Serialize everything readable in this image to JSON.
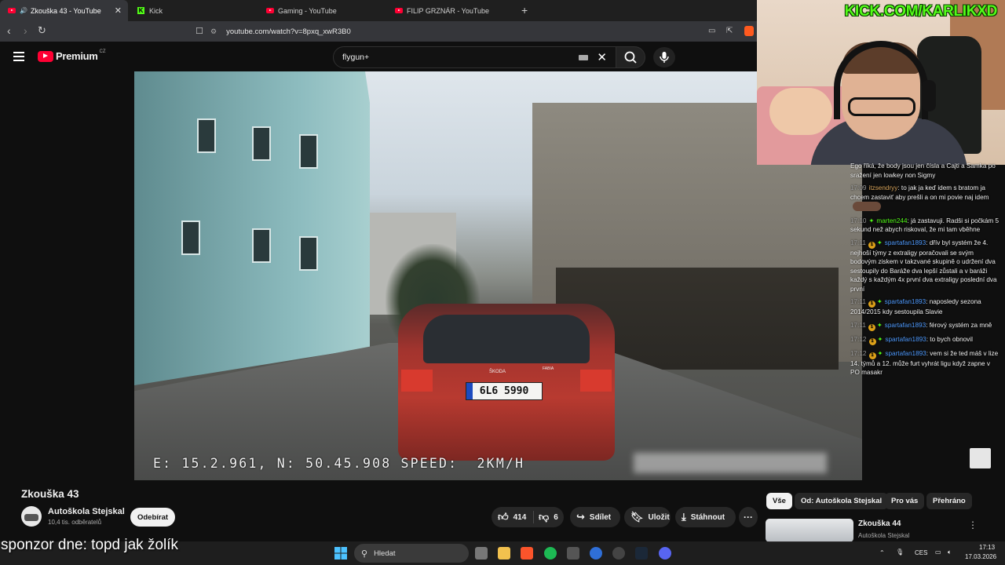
{
  "browser": {
    "tabs": [
      {
        "label": "Zkouška 43 - YouTube",
        "icon": "youtube-icon",
        "active": true
      },
      {
        "label": "Kick",
        "icon": "kick-icon"
      },
      {
        "label": "Gaming - YouTube",
        "icon": "youtube-icon"
      },
      {
        "label": "FILIP GRZNÁR - YouTube",
        "icon": "youtube-icon"
      }
    ],
    "url": "youtube.com/watch?v=8pxq_xwR3B0"
  },
  "youtube": {
    "logo_text": "Premium",
    "logo_region": "CZ",
    "search_query": "flygun+",
    "video": {
      "osd_text": "E: 15.2.961, N: 50.45.908 SPEED:  2KM/H",
      "plate": "6L6 5990",
      "car_badge": "ŠKODA",
      "car_model": "FABIA"
    },
    "title": "Zkouška 43",
    "channel": {
      "name": "Autoškola Stejskal",
      "subscribers": "10,4 tis. odběratelů"
    },
    "subscribe_label": "Odebírat",
    "actions": {
      "likes": "414",
      "dislikes": "6",
      "share": "Sdílet",
      "save": "Uložit",
      "download": "Stáhnout",
      "more": "···"
    },
    "chips": [
      "Vše",
      "Od: Autoškola Stejskal",
      "Pro vás",
      "Přehráno"
    ],
    "related": {
      "title": "Zkouška 44",
      "channel": "Autoškola Stejskal"
    }
  },
  "stream": {
    "kick_tag": "KICK.COM/KARLIKXD",
    "sponsor": "sponzor dne: topd jak žolík",
    "chat": [
      {
        "time": "",
        "user": "",
        "text": "Ego říká, že body jsou jen čísla a Cajti a Samka po sražení jen lowkey non Sigmy",
        "badges": false
      },
      {
        "time": "17:09",
        "user": "itzsendryy",
        "text": "to jak ja keď idem s bratom ja chcem zastaviť aby prešli a on mi povie naj idem",
        "badges": false,
        "emote": true
      },
      {
        "time": "17:10",
        "user": "marten244",
        "text": "já zastavuji. Radši si počkám 5 sekund než abych riskoval, že mi tam vběhne",
        "badges": true
      },
      {
        "time": "17:11",
        "user": "spartafan1893",
        "text": "dřív byl systém že 4. nejhoší týmy z extraligy poračovali se svým bodovým ziskem v takzvané skupině o udržení dva sestoupily do Baráže dva lepší zůstali a v baráži každý s každým 4x první dva extraligy poslední dva první",
        "badges": true
      },
      {
        "time": "17:11",
        "user": "spartafan1893",
        "text": "naposledy sezona 2014/2015 kdy sestoupila Slavie",
        "badges": true
      },
      {
        "time": "17:11",
        "user": "spartafan1893",
        "text": "férový systém za mně",
        "badges": true
      },
      {
        "time": "17:12",
        "user": "spartafan1893",
        "text": "to bych obnovil",
        "badges": true
      },
      {
        "time": "17:12",
        "user": "spartafan1893",
        "text": "vem si že ted máš v lize 14. týmů a 12. může furt vyhrát ligu když zapne v PO masakr",
        "badges": true
      }
    ]
  },
  "taskbar": {
    "search_placeholder": "Hledat",
    "lang": "CES",
    "time": "17:13",
    "date": "17.03.2026"
  },
  "colors": {
    "youtube_red": "#ff0033",
    "kick_green": "#53fc18",
    "user_color_a": "#d6a35b",
    "user_color_b": "#53fc18",
    "user_color_c": "#4f9bff"
  }
}
